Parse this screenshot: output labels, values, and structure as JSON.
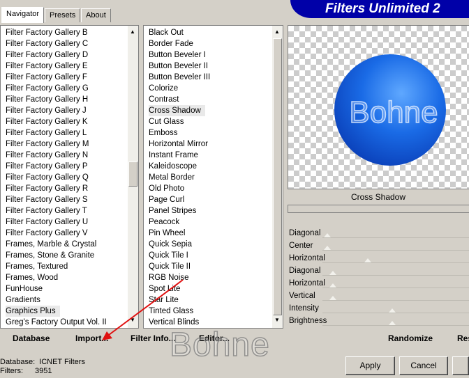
{
  "app_title": "Filters Unlimited 2",
  "tabs": [
    {
      "label": "Navigator",
      "active": true
    },
    {
      "label": "Presets",
      "active": false
    },
    {
      "label": "About",
      "active": false
    }
  ],
  "categories": [
    "Filter Factory Gallery B",
    "Filter Factory Gallery C",
    "Filter Factory Gallery D",
    "Filter Factory Gallery E",
    "Filter Factory Gallery F",
    "Filter Factory Gallery G",
    "Filter Factory Gallery H",
    "Filter Factory Gallery J",
    "Filter Factory Gallery K",
    "Filter Factory Gallery L",
    "Filter Factory Gallery M",
    "Filter Factory Gallery N",
    "Filter Factory Gallery P",
    "Filter Factory Gallery Q",
    "Filter Factory Gallery R",
    "Filter Factory Gallery S",
    "Filter Factory Gallery T",
    "Filter Factory Gallery U",
    "Filter Factory Gallery V",
    "Frames, Marble & Crystal",
    "Frames, Stone & Granite",
    "Frames, Textured",
    "Frames, Wood",
    "FunHouse",
    "Gradients",
    "Graphics Plus",
    "Greg's Factory Output Vol. II"
  ],
  "selected_category": "Graphics Plus",
  "filters": [
    "Black Out",
    "Border Fade",
    "Button Beveler I",
    "Button Beveler II",
    "Button Beveler III",
    "Colorize",
    "Contrast",
    "Cross Shadow",
    "Cut Glass",
    "Emboss",
    "Horizontal Mirror",
    "Instant Frame",
    "Kaleidoscope",
    "Metal Border",
    "Old Photo",
    "Page Curl",
    "Panel Stripes",
    "Peacock",
    "Pin Wheel",
    "Quick Sepia",
    "Quick Tile I",
    "Quick Tile II",
    "RGB Noise",
    "Spot Lite",
    "Star Lite",
    "Tinted Glass",
    "Vertical Blinds"
  ],
  "selected_filter": "Cross Shadow",
  "preview_text": "Bohne",
  "current_filter_name": "Cross Shadow",
  "parameters": [
    "Diagonal",
    "Center",
    "Horizontal",
    "Diagonal",
    "Horizontal",
    "Vertical",
    "Intensity",
    "Brightness"
  ],
  "toolbar": {
    "database": "Database",
    "import": "Import...",
    "filter_info": "Filter Info...",
    "editor": "Editor...",
    "randomize": "Randomize",
    "reset": "Res"
  },
  "info": {
    "database_label": "Database:",
    "database_value": "ICNET Filters",
    "filters_label": "Filters:",
    "filters_value": "3951"
  },
  "buttons": {
    "apply": "Apply",
    "cancel": "Cancel"
  },
  "watermark": "Bohne",
  "colors": {
    "banner": "#0000a8",
    "arrow": "#e01010"
  }
}
